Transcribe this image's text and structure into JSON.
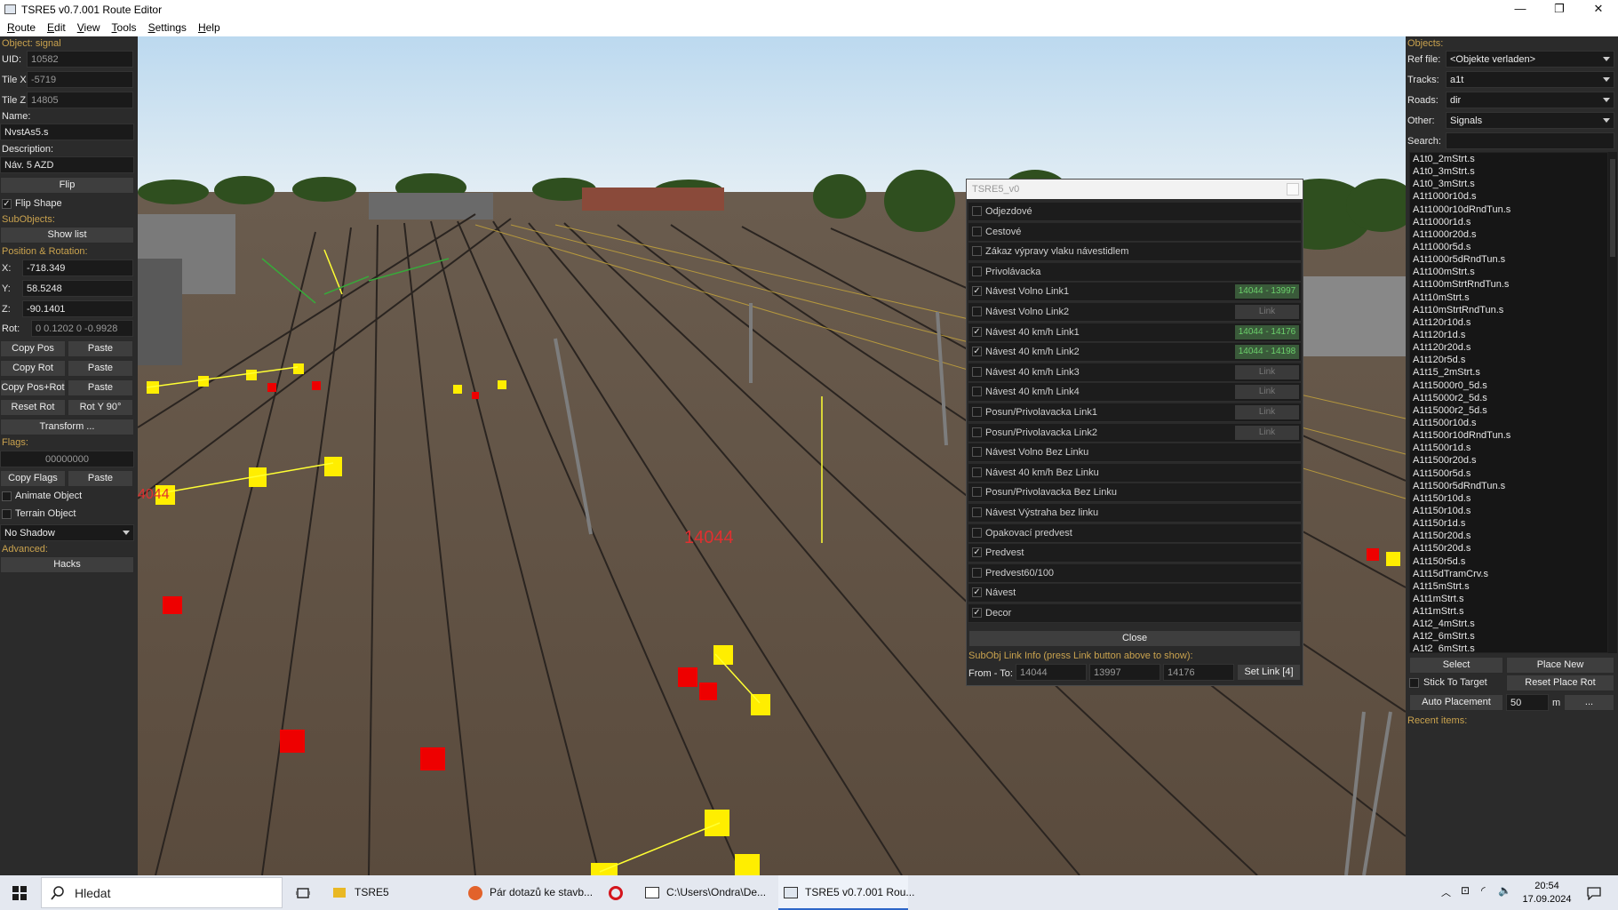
{
  "window": {
    "title": "TSRE5 v0.7.001 Route Editor"
  },
  "menu": [
    "Route",
    "Edit",
    "View",
    "Tools",
    "Settings",
    "Help"
  ],
  "left": {
    "object_label": "Object: signal",
    "uid_label": "UID:",
    "uid": "10582",
    "tilex_label": "Tile X:",
    "tilex": "-5719",
    "tilez_label": "Tile Z:",
    "tilez": "14805",
    "name_label": "Name:",
    "name": "NvstAs5.s",
    "desc_label": "Description:",
    "desc": "Náv. 5 AZD",
    "flip": "Flip",
    "flip_shape": "Flip Shape",
    "subobjects": "SubObjects:",
    "show_list": "Show list",
    "pos_rot": "Position & Rotation:",
    "x_label": "X:",
    "x": "-718.349",
    "y_label": "Y:",
    "y": "58.5248",
    "z_label": "Z:",
    "z": "-90.1401",
    "rot_label": "Rot:",
    "rot": "0 0.1202 0 -0.9928",
    "copy_pos": "Copy Pos",
    "paste": "Paste",
    "copy_rot": "Copy Rot",
    "copy_pos_rot": "Copy Pos+Rot",
    "reset_rot": "Reset Rot",
    "rot_y": "Rot Y 90°",
    "transform": "Transform ...",
    "flags_label": "Flags:",
    "flags": "00000000",
    "copy_flags": "Copy Flags",
    "animate": "Animate Object",
    "terrain": "Terrain Object",
    "shadow": "No Shadow",
    "advanced": "Advanced:",
    "hacks": "Hacks"
  },
  "right": {
    "objects": "Objects:",
    "ref_label": "Ref file:",
    "ref": "<Objekte verladen>",
    "tracks_label": "Tracks:",
    "tracks": "a1t",
    "roads_label": "Roads:",
    "roads": "dir",
    "other_label": "Other:",
    "other": "Signals",
    "search_label": "Search:",
    "items": [
      "A1t0_2mStrt.s",
      "A1t0_3mStrt.s",
      "A1t0_3mStrt.s",
      "A1t1000r10d.s",
      "A1t1000r10dRndTun.s",
      "A1t1000r1d.s",
      "A1t1000r20d.s",
      "A1t1000r5d.s",
      "A1t1000r5dRndTun.s",
      "A1t100mStrt.s",
      "A1t100mStrtRndTun.s",
      "A1t10mStrt.s",
      "A1t10mStrtRndTun.s",
      "A1t120r10d.s",
      "A1t120r1d.s",
      "A1t120r20d.s",
      "A1t120r5d.s",
      "A1t15_2mStrt.s",
      "A1t15000r0_5d.s",
      "A1t15000r2_5d.s",
      "A1t15000r2_5d.s",
      "A1t1500r10d.s",
      "A1t1500r10dRndTun.s",
      "A1t1500r1d.s",
      "A1t1500r20d.s",
      "A1t1500r5d.s",
      "A1t1500r5dRndTun.s",
      "A1t150r10d.s",
      "A1t150r10d.s",
      "A1t150r1d.s",
      "A1t150r20d.s",
      "A1t150r20d.s",
      "A1t150r5d.s",
      "A1t15dTramCrv.s",
      "A1t15mStrt.s",
      "A1t1mStrt.s",
      "A1t1mStrt.s",
      "A1t2_4mStrt.s",
      "A1t2_6mStrt.s",
      "A1t2_6mStrt.s"
    ],
    "select": "Select",
    "place_new": "Place New",
    "stick": "Stick To Target",
    "reset_place": "Reset Place Rot",
    "auto": "Auto Placement",
    "auto_val": "50",
    "unit": "m",
    "more": "...",
    "recent": "Recent items:"
  },
  "dialog": {
    "title": "TSRE5_v0",
    "rows": [
      {
        "label": "Odjezdové",
        "checked": false,
        "link": ""
      },
      {
        "label": "Cestové",
        "checked": false,
        "link": ""
      },
      {
        "label": "Zákaz výpravy vlaku návestidlem",
        "checked": false,
        "link": ""
      },
      {
        "label": "Privolávacka",
        "checked": false,
        "link": ""
      },
      {
        "label": "Návest Volno Link1",
        "checked": true,
        "link": "14044 - 13997",
        "on": true
      },
      {
        "label": "Návest Volno Link2",
        "checked": false,
        "link": "Link"
      },
      {
        "label": "Návest 40 km/h Link1",
        "checked": true,
        "link": "14044 - 14176",
        "on": true
      },
      {
        "label": "Návest 40 km/h Link2",
        "checked": true,
        "link": "14044 - 14198",
        "on": true
      },
      {
        "label": "Návest 40 km/h Link3",
        "checked": false,
        "link": "Link"
      },
      {
        "label": "Návest 40 km/h Link4",
        "checked": false,
        "link": "Link"
      },
      {
        "label": "Posun/Privolavacka Link1",
        "checked": false,
        "link": "Link"
      },
      {
        "label": "Posun/Privolavacka Link2",
        "checked": false,
        "link": "Link"
      },
      {
        "label": "Návest Volno Bez Linku",
        "checked": false,
        "link": ""
      },
      {
        "label": "Návest 40 km/h Bez Linku",
        "checked": false,
        "link": ""
      },
      {
        "label": "Posun/Privolavacka Bez Linku",
        "checked": false,
        "link": ""
      },
      {
        "label": "Návest Výstraha bez linku",
        "checked": false,
        "link": ""
      },
      {
        "label": "Opakovací predvest",
        "checked": false,
        "link": ""
      },
      {
        "label": "Predvest",
        "checked": true,
        "link": ""
      },
      {
        "label": "Predvest60/100",
        "checked": false,
        "link": ""
      },
      {
        "label": "Návest",
        "checked": true,
        "link": ""
      },
      {
        "label": "Decor",
        "checked": true,
        "link": ""
      }
    ],
    "close": "Close",
    "info": "SubObj Link Info (press Link button above to show):",
    "from_to": "From - To:",
    "f1": "14044",
    "f2": "13997",
    "f3": "14176",
    "set_link": "Set Link [4]"
  },
  "scene": {
    "marker1": "14044",
    "marker2": "4044"
  },
  "taskbar": {
    "search": "Hledat",
    "apps": [
      "TSRE5",
      "Pár dotazů ke stavb...",
      "C:\\Users\\Ondra\\De...",
      "TSRE5 v0.7.001 Rou..."
    ],
    "time": "20:54",
    "date": "17.09.2024"
  }
}
